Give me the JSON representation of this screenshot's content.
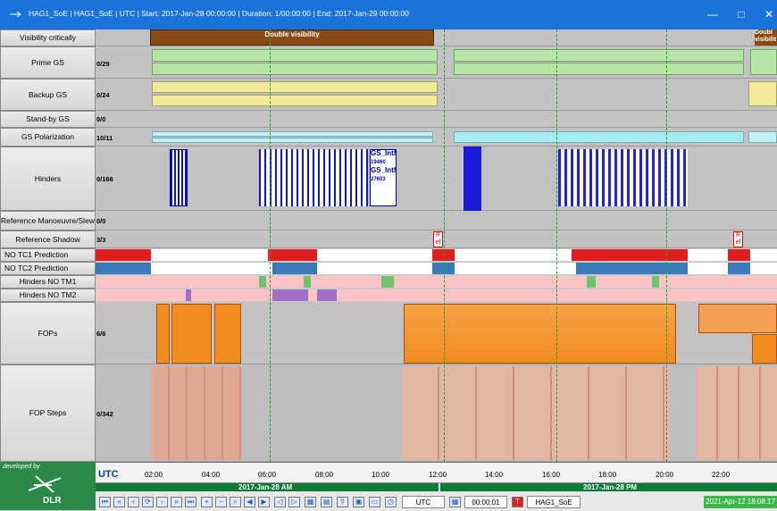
{
  "window": {
    "title": "HAG1_SoE | HAG1_SoE | UTC | Start: 2017-Jan-28 00:00:00 | Duration: 1/00:00:00 | End: 2017-Jan-29 00:00:00",
    "minimize": "—",
    "maximize": "□",
    "close": "✕"
  },
  "rows": [
    {
      "label": "Visibility critically",
      "count": ""
    },
    {
      "label": "Prime GS",
      "count": "0/29"
    },
    {
      "label": "Backup GS",
      "count": "0/24"
    },
    {
      "label": "Stand-by GS",
      "count": "0/0"
    },
    {
      "label": "GS Polarization",
      "count": "10/11"
    },
    {
      "label": "Hinders",
      "count": "0/166"
    },
    {
      "label": "Reference Manoeuvre/Slew",
      "count": "0/0"
    },
    {
      "label": "Reference Shadow",
      "count": "3/3"
    },
    {
      "label": "NO TC1 Prediction",
      "count": ""
    },
    {
      "label": "NO TC2 Prediction",
      "count": ""
    },
    {
      "label": "Hinders NO TM1",
      "count": ""
    },
    {
      "label": "Hinders NO TM2",
      "count": ""
    },
    {
      "label": "FOPs",
      "count": "6/6"
    },
    {
      "label": "FOP Steps",
      "count": "0/342"
    }
  ],
  "bars": {
    "double_visibility": "Double visibility",
    "double_visibility_right": "Doubl visibilit",
    "gs_intf_1": "GS_Intf",
    "gs_intf_1_num": "19460",
    "gs_intf_2": "GS_Intf",
    "gs_intf_2_num": "27603",
    "ref_marker": "R ef"
  },
  "timeline": {
    "zone": "UTC",
    "ticks": [
      "02:00",
      "04:00",
      "06:00",
      "08:00",
      "10:00",
      "12:00",
      "14:00",
      "16:00",
      "18:00",
      "20:00",
      "22:00"
    ],
    "day1": "2017-Jan-28 AM",
    "day2": "2017-Jan-28 PM"
  },
  "branding": {
    "developed_by": "developed by",
    "org": "DLR"
  },
  "toolbar": {
    "utc": "UTC",
    "duration": "00:00:01",
    "soe": "HAG1_SoE",
    "datetime": "2021-Apr-12 18:08:17"
  },
  "colors": {
    "title": "#1a73d9",
    "green": "#0d7a35",
    "red": "#e02020",
    "blue": "#3a7ab8",
    "orange": "#f28c1e"
  }
}
